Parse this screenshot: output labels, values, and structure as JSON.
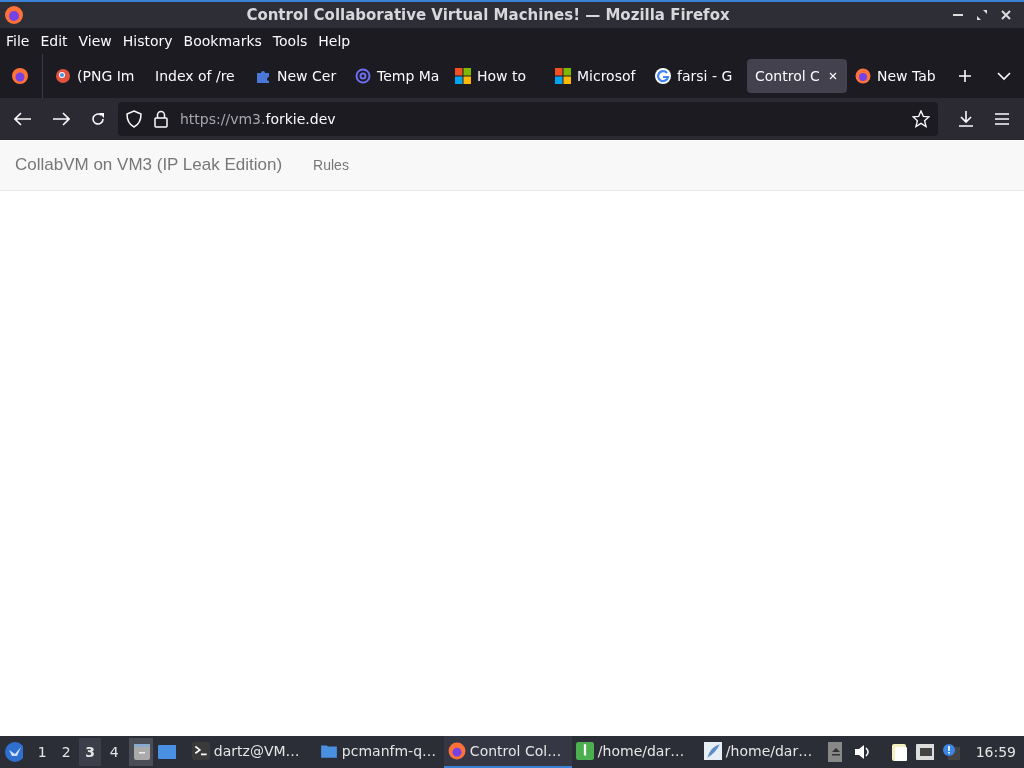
{
  "window": {
    "title": "Control Collaborative Virtual Machines! — Mozilla Firefox"
  },
  "menu": [
    "File",
    "Edit",
    "View",
    "History",
    "Bookmarks",
    "Tools",
    "Help"
  ],
  "tabs": [
    {
      "label": "(PNG Im",
      "kind": "magnifier",
      "selected": false
    },
    {
      "label": "Index of /re",
      "kind": "plain",
      "selected": false
    },
    {
      "label": "New Cer",
      "kind": "puzzle",
      "selected": false
    },
    {
      "label": "Temp Ma",
      "kind": "at",
      "selected": false
    },
    {
      "label": "How to",
      "kind": "squares",
      "selected": false
    },
    {
      "label": "Microsof",
      "kind": "squares",
      "selected": false
    },
    {
      "label": "farsi - G",
      "kind": "g",
      "selected": false
    },
    {
      "label": "Control C",
      "kind": "plain",
      "selected": true
    },
    {
      "label": "New Tab",
      "kind": "firefox",
      "selected": false
    }
  ],
  "address": {
    "prefix": "https://vm3.",
    "domain": "forkie.dev"
  },
  "page": {
    "brand": "CollabVM on VM3 (IP Leak Edition)",
    "nav": [
      "Rules"
    ]
  },
  "taskbar": {
    "workspaces": [
      {
        "label": "1",
        "selected": false
      },
      {
        "label": "2",
        "selected": false
      },
      {
        "label": "3",
        "selected": true
      },
      {
        "label": "4",
        "selected": false
      }
    ],
    "tasks": [
      {
        "label": "dartz@VM…",
        "kind": "terminal",
        "selected": false
      },
      {
        "label": "pcmanfm-q…",
        "kind": "folder",
        "selected": false
      },
      {
        "label": "Control Col…",
        "kind": "firefox",
        "selected": true
      },
      {
        "label": "/home/dar…",
        "kind": "archive",
        "selected": false
      },
      {
        "label": "/home/dar…",
        "kind": "feather",
        "selected": false
      }
    ],
    "clock": "16:59"
  }
}
